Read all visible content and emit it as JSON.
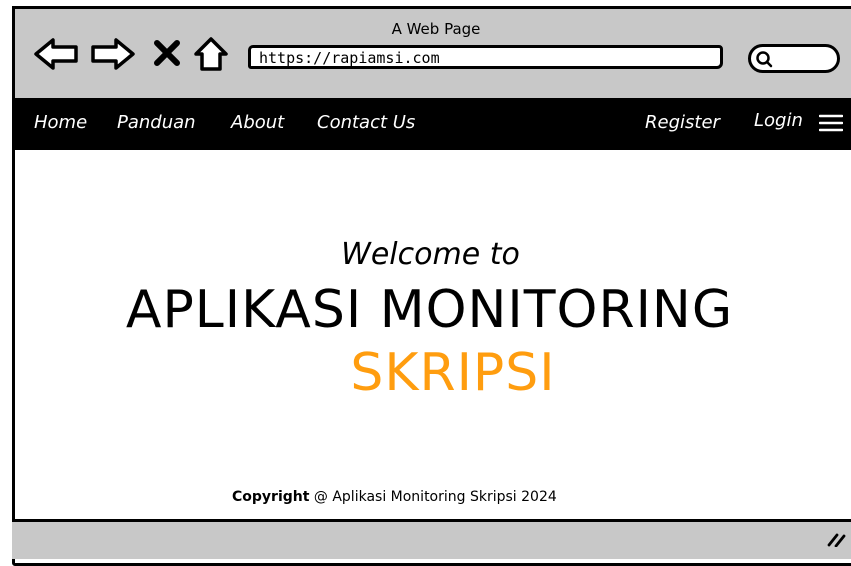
{
  "window": {
    "title": "A Web Page"
  },
  "toolbar": {
    "icons": [
      "back-arrow-icon",
      "forward-arrow-icon",
      "close-icon",
      "home-icon"
    ],
    "url": "https://rapiamsi.com",
    "search_icon": "search-icon"
  },
  "nav": {
    "left": [
      "Home",
      "Panduan",
      "About",
      "Contact Us"
    ],
    "right": [
      "Register",
      "Login"
    ],
    "menu_icon": "hamburger-menu-icon"
  },
  "hero": {
    "welcome": "Welcome to",
    "title": "APLIKASI MONITORING",
    "subtitle": "SKRIPSI",
    "subtitle_color": "#ff9d0f"
  },
  "footer": {
    "copyright_label": "Copyright",
    "text": "@ Aplikasi Monitoring Skripsi 2024"
  },
  "statusbar": {
    "grip_icon": "resize-grip-icon"
  },
  "colors": {
    "chrome": "#c8c8c8",
    "navbar": "#000000",
    "accent": "#ff9d0f"
  }
}
